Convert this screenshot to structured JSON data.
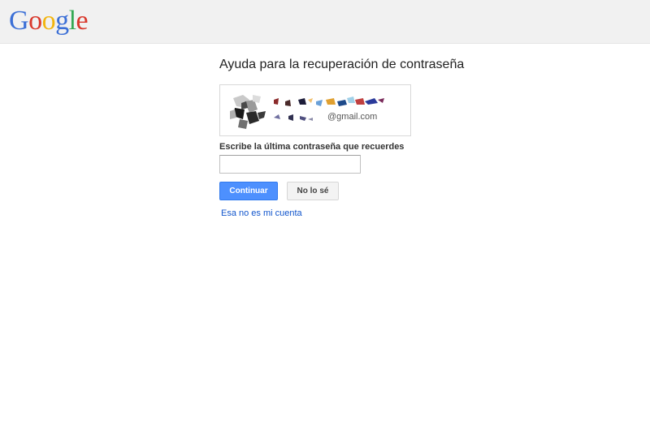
{
  "header": {
    "logo_text": "Google",
    "logo_letters": [
      {
        "char": "G",
        "color": "#3b6fd6"
      },
      {
        "char": "o",
        "color": "#d9382c"
      },
      {
        "char": "o",
        "color": "#f2b50f"
      },
      {
        "char": "g",
        "color": "#3b6fd6"
      },
      {
        "char": "l",
        "color": "#34a853"
      },
      {
        "char": "e",
        "color": "#d9382c"
      }
    ]
  },
  "main": {
    "title": "Ayuda para la recuperación de contraseña",
    "account": {
      "avatar_icon": "redacted-avatar-icon",
      "email_domain": "@gmail.com"
    },
    "password_label": "Escribe la última contraseña que recuerdes",
    "password_value": "",
    "continue_label": "Continuar",
    "dont_know_label": "No lo sé",
    "not_my_account_link": "Esa no es mi cuenta"
  },
  "colors": {
    "primary_button": "#4d90fe",
    "link": "#1155cc",
    "header_bg": "#f1f1f1"
  }
}
